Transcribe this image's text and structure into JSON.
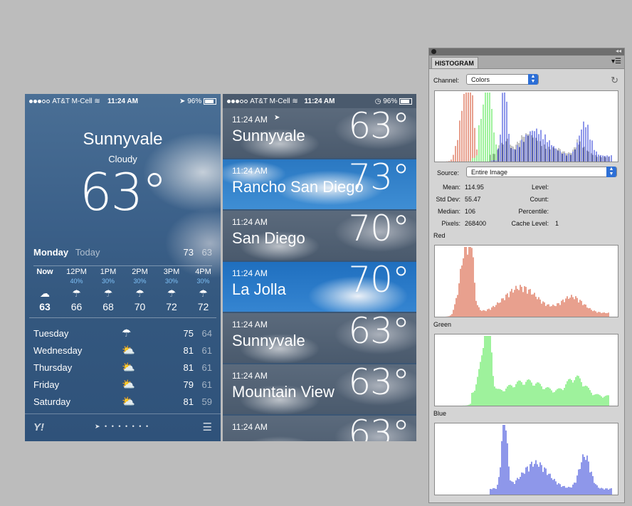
{
  "phone1": {
    "status": {
      "carrier": "AT&T M-Cell",
      "time": "11:24 AM",
      "battery": "96%"
    },
    "city": "Sunnyvale",
    "condition": "Cloudy",
    "temp": "63°",
    "today": {
      "day": "Monday",
      "label": "Today",
      "high": "73",
      "low": "63"
    },
    "hourly": [
      {
        "time": "Now",
        "pct": "",
        "icon": "cloud-icon",
        "temp": "63"
      },
      {
        "time": "12PM",
        "pct": "40%",
        "icon": "rain-icon",
        "temp": "66"
      },
      {
        "time": "1PM",
        "pct": "30%",
        "icon": "rain-icon",
        "temp": "68"
      },
      {
        "time": "2PM",
        "pct": "30%",
        "icon": "rain-icon",
        "temp": "70"
      },
      {
        "time": "3PM",
        "pct": "30%",
        "icon": "rain-icon",
        "temp": "72"
      },
      {
        "time": "4PM",
        "pct": "30%",
        "icon": "rain-icon",
        "temp": "72"
      }
    ],
    "daily": [
      {
        "day": "Tuesday",
        "icon": "rain-icon",
        "high": "75",
        "low": "64"
      },
      {
        "day": "Wednesday",
        "icon": "partly-sunny-icon",
        "high": "81",
        "low": "61"
      },
      {
        "day": "Thursday",
        "icon": "partly-sunny-icon",
        "high": "81",
        "low": "61"
      },
      {
        "day": "Friday",
        "icon": "partly-sunny-icon",
        "high": "79",
        "low": "61"
      },
      {
        "day": "Saturday",
        "icon": "partly-sunny-icon",
        "high": "81",
        "low": "59"
      }
    ],
    "logo": "Y!"
  },
  "phone2": {
    "status": {
      "carrier": "AT&T M-Cell",
      "time": "11:24 AM",
      "battery": "96%"
    },
    "cities": [
      {
        "time": "11:24 AM",
        "name": "Sunnyvale",
        "temp": "63°",
        "sky": "cloudy"
      },
      {
        "time": "11:24 AM",
        "name": "Rancho San Diego",
        "temp": "73°",
        "sky": "sunny"
      },
      {
        "time": "11:24 AM",
        "name": "San Diego",
        "temp": "70°",
        "sky": "cloudy"
      },
      {
        "time": "11:24 AM",
        "name": "La Jolla",
        "temp": "70°",
        "sky": "bluecloud"
      },
      {
        "time": "11:24 AM",
        "name": "Sunnyvale",
        "temp": "63°",
        "sky": "cloudy"
      },
      {
        "time": "11:24 AM",
        "name": "Mountain View",
        "temp": "63°",
        "sky": "cloudy"
      },
      {
        "time": "11:24 AM",
        "name": "",
        "temp": "63°",
        "sky": "cloudy"
      }
    ]
  },
  "histogram": {
    "tab": "HISTOGRAM",
    "channel_label": "Channel:",
    "channel_value": "Colors",
    "source_label": "Source:",
    "source_value": "Entire Image",
    "stats": {
      "mean_label": "Mean:",
      "mean": "114.95",
      "stddev_label": "Std Dev:",
      "stddev": "55.47",
      "median_label": "Median:",
      "median": "106",
      "pixels_label": "Pixels:",
      "pixels": "268400",
      "level_label": "Level:",
      "count_label": "Count:",
      "percentile_label": "Percentile:",
      "cache_label": "Cache Level:",
      "cache": "1"
    },
    "red_label": "Red",
    "green_label": "Green",
    "blue_label": "Blue",
    "colors": {
      "red": "#d2421e",
      "green": "#3ee63a",
      "blue": "#1e2fd6"
    }
  }
}
